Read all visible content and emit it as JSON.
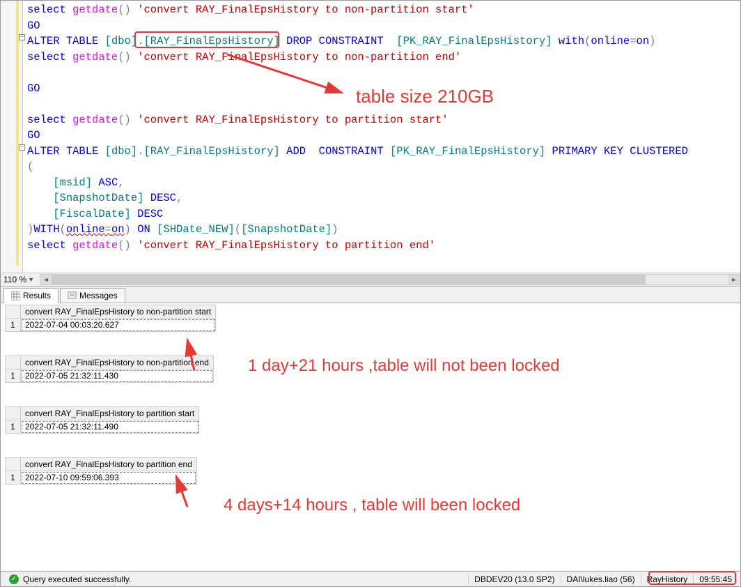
{
  "zoom": "110 %",
  "code": {
    "l1": {
      "select": "select",
      "fn": "getdate",
      "p": "()",
      "str": "'convert RAY_FinalEpsHistory to non-partition start'"
    },
    "l2": {
      "go": "GO"
    },
    "l3": {
      "alter": "ALTER",
      "table": "TABLE",
      "schema": "[dbo]",
      "dot": ".",
      "tbl": "[RAY_FinalEpsHistory]",
      "drop": "DROP",
      "constraint": "CONSTRAINT",
      "pk": "[PK_RAY_FinalEpsHistory]",
      "with": "with",
      "p1": "(",
      "online": "online",
      "eq": "=",
      "on": "on",
      "p2": ")"
    },
    "l4": {
      "select": "select",
      "fn": "getdate",
      "p": "()",
      "str": "'convert RAY_FinalEpsHistory to non-partition end'"
    },
    "l5": {
      "go": "GO"
    },
    "l6": {
      "select": "select",
      "fn": "getdate",
      "p": "()",
      "str": "'convert RAY_FinalEpsHistory to partition start'"
    },
    "l7": {
      "go": "GO"
    },
    "l8": {
      "alter": "ALTER",
      "table": "TABLE",
      "schema": "[dbo]",
      "dot": ".",
      "tbl": "[RAY_FinalEpsHistory]",
      "add": "ADD",
      "constraint": "CONSTRAINT",
      "pk": "[PK_RAY_FinalEpsHistory]",
      "primary": "PRIMARY",
      "key": "KEY",
      "clustered": "CLUSTERED"
    },
    "l9": {
      "p": "("
    },
    "l10": {
      "col": "[msid]",
      "dir": "ASC",
      "c": ","
    },
    "l11": {
      "col": "[SnapshotDate]",
      "dir": "DESC",
      "c": ","
    },
    "l12": {
      "col": "[FiscalDate]",
      "dir": "DESC"
    },
    "l13": {
      "p1": ")",
      "with": "WITH",
      "p2": "(",
      "online": "online",
      "eq": "=",
      "on": "on",
      "p3": ")",
      "onkw": "ON",
      "ps": "[SHDate_NEW]",
      "p4": "(",
      "pc": "[SnapshotDate]",
      "p5": ")"
    },
    "l14": {
      "select": "select",
      "fn": "getdate",
      "p": "()",
      "str": "'convert RAY_FinalEpsHistory to partition end'"
    }
  },
  "tabs": {
    "results": "Results",
    "messages": "Messages"
  },
  "results": [
    {
      "header": "convert RAY_FinalEpsHistory to non-partition start",
      "rownum": "1",
      "value": "2022-07-04 00:03:20.627"
    },
    {
      "header": "convert RAY_FinalEpsHistory to non-partition end",
      "rownum": "1",
      "value": "2022-07-05 21:32:11.430"
    },
    {
      "header": "convert RAY_FinalEpsHistory to partition start",
      "rownum": "1",
      "value": "2022-07-05 21:32:11.490"
    },
    {
      "header": "convert RAY_FinalEpsHistory to partition end",
      "rownum": "1",
      "value": "2022-07-10 09:59:06.393"
    }
  ],
  "status": {
    "msg": "Query executed successfully.",
    "server": "DBDEV20 (13.0 SP2)",
    "user": "DAI\\lukes.liao (56)",
    "db": "RayHistory",
    "time": "09:55:45"
  },
  "annotations": {
    "tablesize": "table size 210GB",
    "dur1": "1 day+21 hours ,table will not been locked",
    "dur2": "4 days+14 hours  , table will been locked"
  }
}
